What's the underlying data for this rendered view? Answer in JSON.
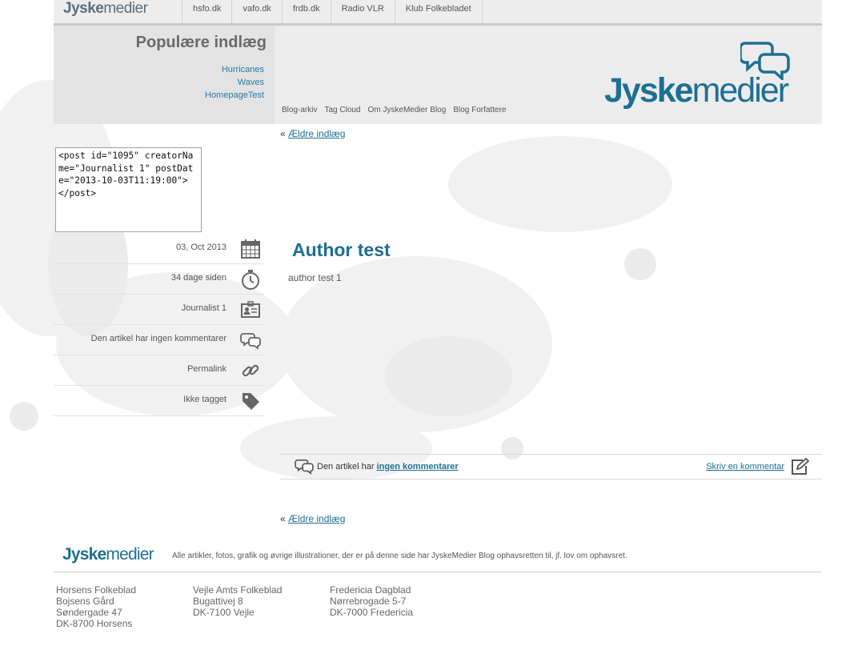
{
  "topbar": {
    "logo_bold": "Jyske",
    "logo_light": "medier",
    "links": [
      "hsfo.dk",
      "vafo.dk",
      "frdb.dk",
      "Radio VLR",
      "Klub Folkebladet"
    ]
  },
  "sidebar": {
    "popular_title": "Populære indlæg",
    "popular_items": [
      "Hurricanes",
      "Waves",
      "HomepageTest"
    ]
  },
  "blog_nav": [
    "Blog-arkiv",
    "Tag Cloud",
    "Om JyskeMedier Blog",
    "Blog Forfattere"
  ],
  "brand": {
    "bold": "Jyske",
    "light": "medier",
    "color": "#1d6f93"
  },
  "post_xml": "<post id=\"1095\" creatorName=\"Journalist 1\" postDate=\"2013-10-03T11:19:00\">\n</post>",
  "meta": [
    {
      "label": "03, Oct 2013",
      "icon": "calendar-icon"
    },
    {
      "label": "34 dage siden",
      "icon": "stopwatch-icon"
    },
    {
      "label": "Journalist 1",
      "icon": "id-card-icon"
    },
    {
      "label": "Den artikel har ingen kommentarer",
      "icon": "speech-bubbles-icon"
    },
    {
      "label": "Permalink",
      "icon": "chain-link-icon"
    },
    {
      "label": "Ikke tagget",
      "icon": "tag-icon"
    }
  ],
  "nav_older": {
    "prefix": "«",
    "label": "Ældre indlæg"
  },
  "post": {
    "title": "Author test",
    "body": "author test 1"
  },
  "comments": {
    "prefix": "Den artikel har",
    "link": "ingen kommentarer",
    "write": "Skriv en kommentar"
  },
  "footer": {
    "logo_bold": "Jyske",
    "logo_light": "medier",
    "copyright": "Alle artikler, fotos, grafik og øvrige illustrationer, der er på denne side har JyskeMedier Blog ophavsretten til, jf. lov om ophavsret.",
    "addresses": [
      {
        "name": "Horsens Folkeblad",
        "l1": "Bojsens Gård",
        "l2": "Søndergade 47",
        "l3": "DK-8700 Horsens"
      },
      {
        "name": "Vejle Amts Folkeblad",
        "l1": "Bugattivej 8",
        "l2": "DK-7100 Vejle",
        "l3": ""
      },
      {
        "name": "Fredericia Dagblad",
        "l1": "Nørrebrogade 5-7",
        "l2": "DK-7000 Fredericia",
        "l3": ""
      }
    ]
  }
}
